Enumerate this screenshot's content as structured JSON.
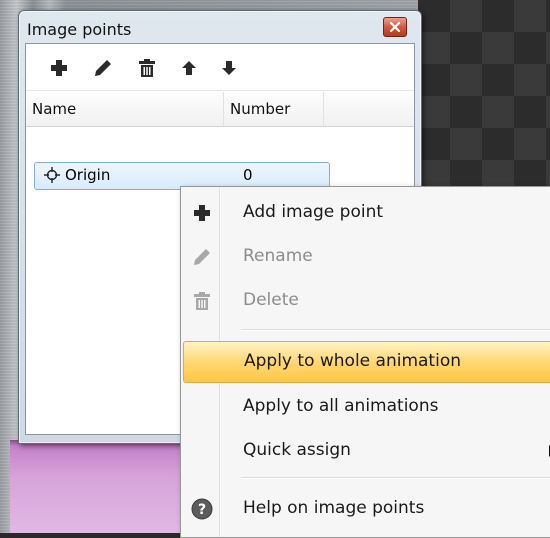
{
  "window": {
    "title": "Image points"
  },
  "toolbar": {
    "buttons": [
      {
        "name": "add-point-button",
        "icon": "plus-icon"
      },
      {
        "name": "rename-point-button",
        "icon": "pencil-icon"
      },
      {
        "name": "delete-point-button",
        "icon": "trash-icon"
      },
      {
        "name": "move-up-button",
        "icon": "arrow-up-icon"
      },
      {
        "name": "move-down-button",
        "icon": "arrow-down-icon"
      }
    ]
  },
  "list": {
    "columns": [
      "Name",
      "Number"
    ],
    "rows": [
      {
        "name": "Origin",
        "number": "0",
        "icon": "crosshair-icon"
      }
    ]
  },
  "menu": {
    "items": [
      {
        "label": "Add image point",
        "icon": "plus-icon",
        "enabled": true
      },
      {
        "label": "Rename",
        "icon": "pencil-icon",
        "enabled": false
      },
      {
        "label": "Delete",
        "icon": "trash-icon",
        "enabled": false
      },
      {
        "label": "Apply to whole animation",
        "icon": "",
        "enabled": true,
        "highlighted": true
      },
      {
        "label": "Apply to all animations",
        "icon": "",
        "enabled": true
      },
      {
        "label": "Quick assign",
        "icon": "",
        "enabled": true,
        "submenu": true
      },
      {
        "label": "Help on image points",
        "icon": "help-icon",
        "enabled": true
      }
    ]
  },
  "colors": {
    "highlight": "#ffd775",
    "selection": "#d8ebfb",
    "close_button": "#d25a41"
  }
}
